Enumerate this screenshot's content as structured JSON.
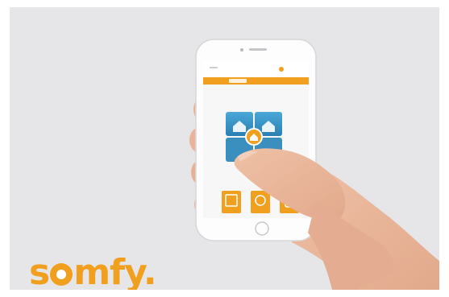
{
  "brand": {
    "logo_text": "somfy.",
    "color": "#f0a01e"
  },
  "phone": {
    "app_accent": "#f0a01e",
    "screen_bg": "#f7f7f7",
    "tile_colors": [
      "#2f8cc4",
      "#4aa7d6"
    ],
    "icons": [
      "home-icon",
      "house-shield-icon",
      "alarm-center-icon",
      "sensor-icon",
      "camera-icon",
      "remote-icon"
    ]
  },
  "background_color": "#e6e6e8"
}
